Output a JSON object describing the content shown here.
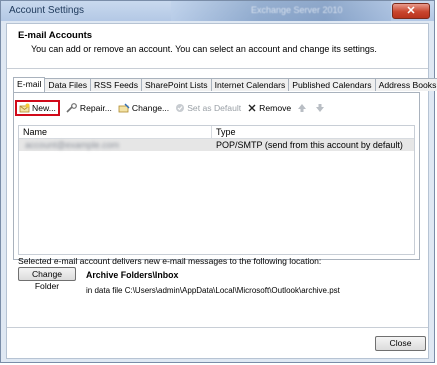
{
  "window": {
    "title": "Account Settings",
    "background_title": "Exchange Server 2010",
    "close_glyph": "✕"
  },
  "header": {
    "title": "E-mail Accounts",
    "subtitle": "You can add or remove an account. You can select an account and change its settings."
  },
  "tabs": [
    {
      "label": "E-mail",
      "active": true
    },
    {
      "label": "Data Files"
    },
    {
      "label": "RSS Feeds"
    },
    {
      "label": "SharePoint Lists"
    },
    {
      "label": "Internet Calendars"
    },
    {
      "label": "Published Calendars"
    },
    {
      "label": "Address Books"
    }
  ],
  "toolbar": {
    "new": "New...",
    "repair": "Repair...",
    "change": "Change...",
    "set_default": "Set as Default",
    "remove": "Remove",
    "move_up_icon": "arrow-up-icon",
    "move_down_icon": "arrow-down-icon"
  },
  "grid": {
    "columns": [
      "Name",
      "Type"
    ],
    "rows": [
      {
        "name": "account@example.com",
        "type": "POP/SMTP (send from this account by default)"
      }
    ]
  },
  "delivery": {
    "description": "Selected e-mail account delivers new e-mail messages to the following location:",
    "change_folder": "Change Folder",
    "folder": "Archive Folders\\Inbox",
    "path": "in data file C:\\Users\\admin\\AppData\\Local\\Microsoft\\Outlook\\archive.pst"
  },
  "footer": {
    "close": "Close"
  },
  "colors": {
    "highlight": "#d10a1a",
    "titlebar": "#c9d9ee",
    "selected_row": "#e6e6e6"
  }
}
